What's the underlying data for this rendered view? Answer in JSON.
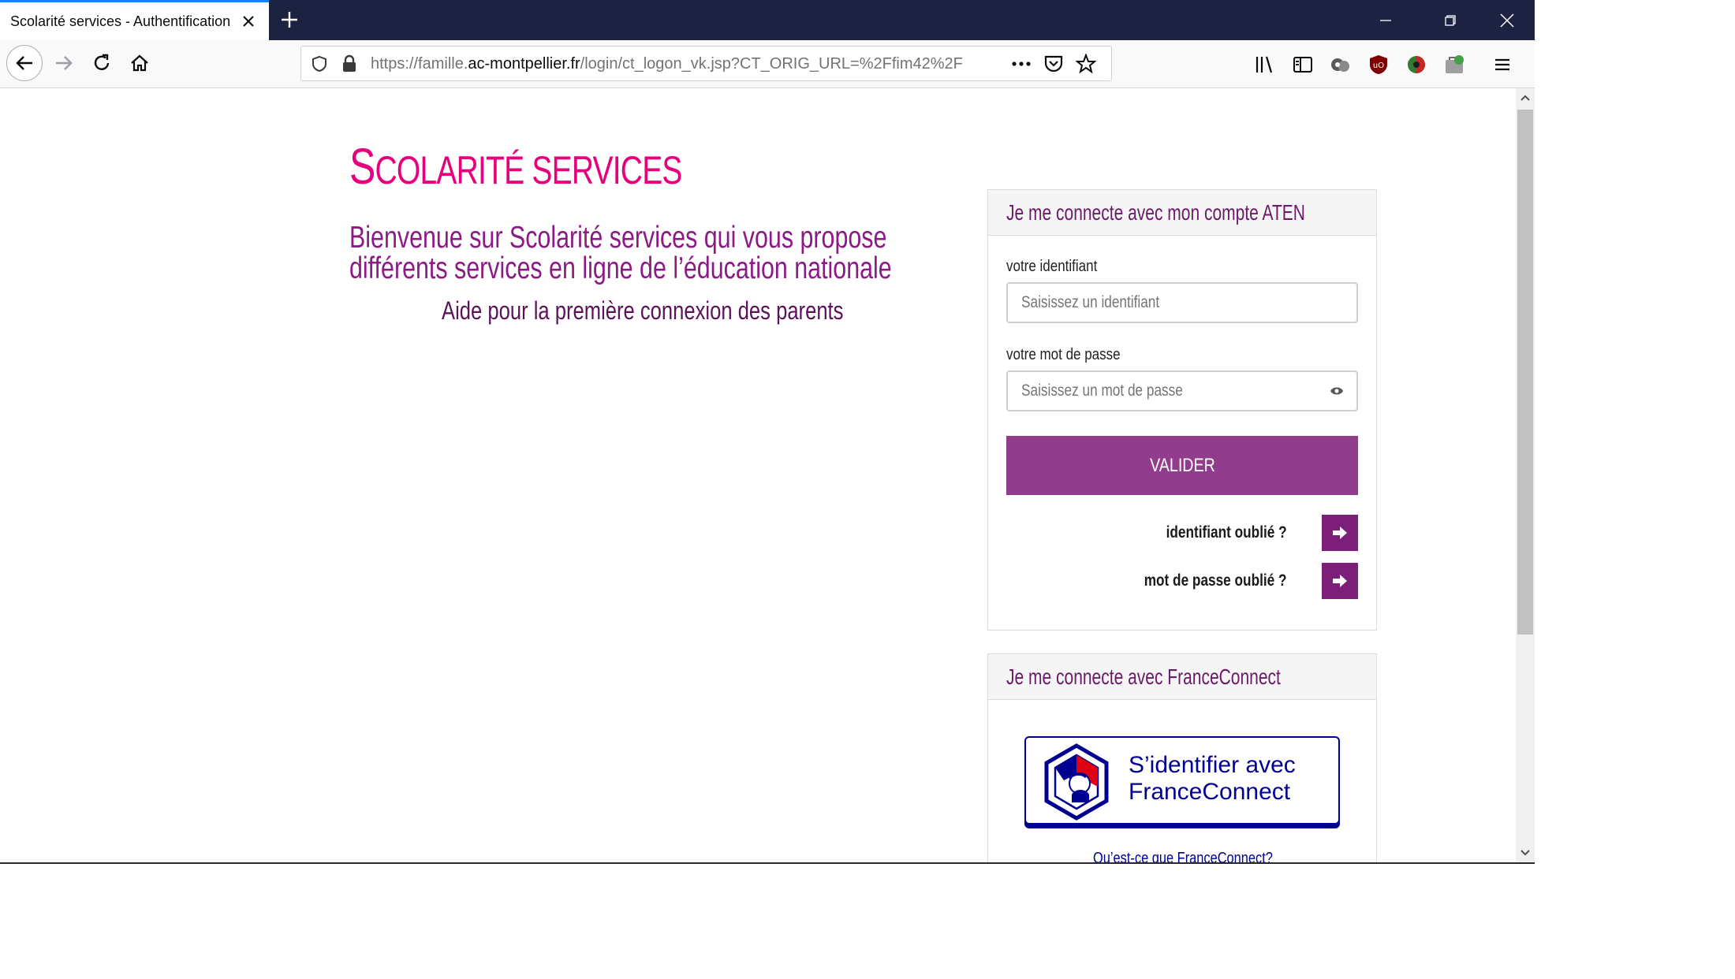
{
  "browser": {
    "tab_title": "Scolarité services - Authentification",
    "url_prefix": "https://famille.",
    "url_domain": "ac-montpellier.fr",
    "url_rest": "/login/ct_logon_vk.jsp?CT_ORIG_URL=%2Ffim42%2F",
    "icons": {
      "close_tab": "close-icon",
      "new_tab": "plus-icon",
      "back": "arrow-left-icon",
      "forward": "arrow-right-icon",
      "reload": "reload-icon",
      "home": "home-icon",
      "tracking": "shield-icon",
      "lock": "lock-icon",
      "page_actions": "more-icon",
      "pocket": "pocket-icon",
      "bookmark": "star-icon",
      "library": "library-icon",
      "sidebar": "sidebar-icon",
      "menu": "hamburger-icon"
    }
  },
  "page": {
    "site_title_initial": "S",
    "site_title_rest": "COLARITÉ SERVICES",
    "welcome_line1": "Bienvenue sur Scolarité services qui vous propose",
    "welcome_line2": "différents services en ligne de l’éducation nationale",
    "help_link": "Aide pour la première connexion des parents"
  },
  "aten_login": {
    "heading": "Je me connecte avec mon compte ATEN",
    "id_label": "votre identifiant",
    "id_placeholder": "Saisissez un identifiant",
    "password_label": "votre mot de passe",
    "password_placeholder": "Saisissez un mot de passe",
    "submit_label": "VALIDER",
    "forgot_id": "identifiant oublié ?",
    "forgot_password": "mot de passe oublié ?"
  },
  "franceconnect": {
    "heading": "Je me connecte avec FranceConnect",
    "button_line1": "S’identifier avec",
    "button_line2": "FranceConnect",
    "what_link": "Qu’est-ce que FranceConnect?"
  },
  "colors": {
    "title_pink": "#e6007e",
    "heading_purple": "#8b1a84",
    "button_purple": "#923c8e",
    "arrow_purple": "#7b1f79",
    "franceconnect_blue": "#000091",
    "tabbar": "#1c2242"
  }
}
